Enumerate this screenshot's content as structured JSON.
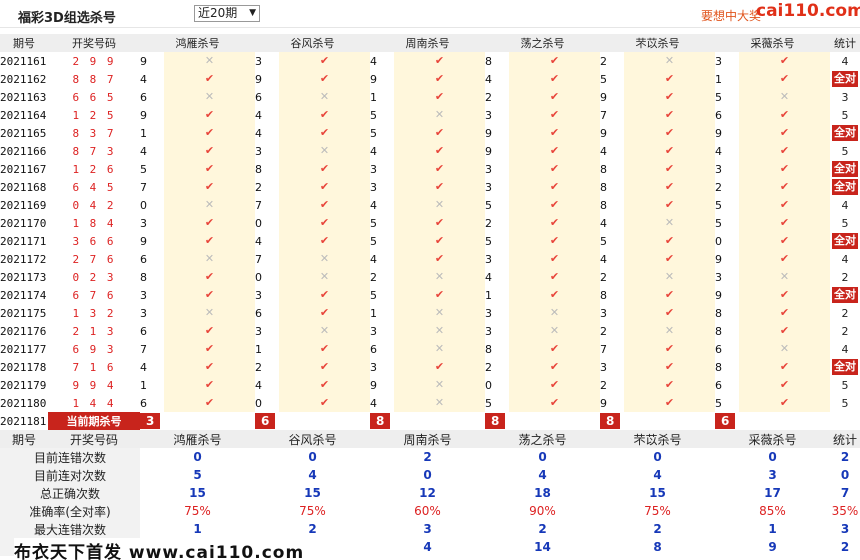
{
  "header": {
    "title": "福彩3D组选杀号",
    "period_select": "近20期",
    "promo_text": "要想中大奖",
    "logo": "cai110.com"
  },
  "columns": {
    "period": "期号",
    "draw": "开奖号码",
    "killers": [
      "鸿雁杀号",
      "谷风杀号",
      "周南杀号",
      "荡之杀号",
      "芣苡杀号",
      "采薇杀号"
    ],
    "total": "统计"
  },
  "rows": [
    {
      "period": "2021161",
      "num": "2 9 9",
      "k": [
        [
          9,
          0
        ],
        [
          3,
          1
        ],
        [
          4,
          1
        ],
        [
          8,
          1
        ],
        [
          2,
          0
        ],
        [
          3,
          1
        ]
      ],
      "total": "4"
    },
    {
      "period": "2021162",
      "num": "8 8 7",
      "k": [
        [
          4,
          1
        ],
        [
          9,
          1
        ],
        [
          9,
          1
        ],
        [
          4,
          1
        ],
        [
          5,
          1
        ],
        [
          1,
          1
        ]
      ],
      "total": "全对"
    },
    {
      "period": "2021163",
      "num": "6 6 5",
      "k": [
        [
          6,
          0
        ],
        [
          6,
          0
        ],
        [
          1,
          1
        ],
        [
          2,
          1
        ],
        [
          9,
          1
        ],
        [
          5,
          0
        ]
      ],
      "total": "3"
    },
    {
      "period": "2021164",
      "num": "1 2 5",
      "k": [
        [
          9,
          1
        ],
        [
          4,
          1
        ],
        [
          5,
          0
        ],
        [
          3,
          1
        ],
        [
          7,
          1
        ],
        [
          6,
          1
        ]
      ],
      "total": "5"
    },
    {
      "period": "2021165",
      "num": "8 3 7",
      "k": [
        [
          1,
          1
        ],
        [
          4,
          1
        ],
        [
          5,
          1
        ],
        [
          9,
          1
        ],
        [
          9,
          1
        ],
        [
          9,
          1
        ]
      ],
      "total": "全对"
    },
    {
      "period": "2021166",
      "num": "8 7 3",
      "k": [
        [
          4,
          1
        ],
        [
          3,
          0
        ],
        [
          4,
          1
        ],
        [
          9,
          1
        ],
        [
          4,
          1
        ],
        [
          4,
          1
        ]
      ],
      "total": "5"
    },
    {
      "period": "2021167",
      "num": "1 2 6",
      "k": [
        [
          5,
          1
        ],
        [
          8,
          1
        ],
        [
          3,
          1
        ],
        [
          3,
          1
        ],
        [
          8,
          1
        ],
        [
          3,
          1
        ]
      ],
      "total": "全对"
    },
    {
      "period": "2021168",
      "num": "6 4 5",
      "k": [
        [
          7,
          1
        ],
        [
          2,
          1
        ],
        [
          3,
          1
        ],
        [
          3,
          1
        ],
        [
          8,
          1
        ],
        [
          2,
          1
        ]
      ],
      "total": "全对"
    },
    {
      "period": "2021169",
      "num": "0 4 2",
      "k": [
        [
          0,
          0
        ],
        [
          7,
          1
        ],
        [
          4,
          0
        ],
        [
          5,
          1
        ],
        [
          8,
          1
        ],
        [
          5,
          1
        ]
      ],
      "total": "4"
    },
    {
      "period": "2021170",
      "num": "1 8 4",
      "k": [
        [
          3,
          1
        ],
        [
          0,
          1
        ],
        [
          5,
          1
        ],
        [
          2,
          1
        ],
        [
          4,
          0
        ],
        [
          5,
          1
        ]
      ],
      "total": "5"
    },
    {
      "period": "2021171",
      "num": "3 6 6",
      "k": [
        [
          9,
          1
        ],
        [
          4,
          1
        ],
        [
          5,
          1
        ],
        [
          5,
          1
        ],
        [
          5,
          1
        ],
        [
          0,
          1
        ]
      ],
      "total": "全对"
    },
    {
      "period": "2021172",
      "num": "2 7 6",
      "k": [
        [
          6,
          0
        ],
        [
          7,
          0
        ],
        [
          4,
          1
        ],
        [
          3,
          1
        ],
        [
          4,
          1
        ],
        [
          9,
          1
        ]
      ],
      "total": "4"
    },
    {
      "period": "2021173",
      "num": "0 2 3",
      "k": [
        [
          8,
          1
        ],
        [
          0,
          0
        ],
        [
          2,
          0
        ],
        [
          4,
          1
        ],
        [
          2,
          0
        ],
        [
          3,
          0
        ]
      ],
      "total": "2"
    },
    {
      "period": "2021174",
      "num": "6 7 6",
      "k": [
        [
          3,
          1
        ],
        [
          3,
          1
        ],
        [
          5,
          1
        ],
        [
          1,
          1
        ],
        [
          8,
          1
        ],
        [
          9,
          1
        ]
      ],
      "total": "全对"
    },
    {
      "period": "2021175",
      "num": "1 3 2",
      "k": [
        [
          3,
          0
        ],
        [
          6,
          1
        ],
        [
          1,
          0
        ],
        [
          3,
          0
        ],
        [
          3,
          1
        ],
        [
          8,
          1
        ]
      ],
      "total": "2"
    },
    {
      "period": "2021176",
      "num": "2 1 3",
      "k": [
        [
          6,
          1
        ],
        [
          3,
          0
        ],
        [
          3,
          0
        ],
        [
          3,
          0
        ],
        [
          2,
          0
        ],
        [
          8,
          1
        ]
      ],
      "total": "2"
    },
    {
      "period": "2021177",
      "num": "6 9 3",
      "k": [
        [
          7,
          1
        ],
        [
          1,
          1
        ],
        [
          6,
          0
        ],
        [
          8,
          1
        ],
        [
          7,
          1
        ],
        [
          6,
          0
        ]
      ],
      "total": "4"
    },
    {
      "period": "2021178",
      "num": "7 1 6",
      "k": [
        [
          4,
          1
        ],
        [
          2,
          1
        ],
        [
          3,
          1
        ],
        [
          2,
          1
        ],
        [
          3,
          1
        ],
        [
          8,
          1
        ]
      ],
      "total": "全对"
    },
    {
      "period": "2021179",
      "num": "9 9 4",
      "k": [
        [
          1,
          1
        ],
        [
          4,
          1
        ],
        [
          9,
          0
        ],
        [
          0,
          1
        ],
        [
          2,
          1
        ],
        [
          6,
          1
        ]
      ],
      "total": "5"
    },
    {
      "period": "2021180",
      "num": "1 4 4",
      "k": [
        [
          6,
          1
        ],
        [
          0,
          1
        ],
        [
          4,
          0
        ],
        [
          5,
          1
        ],
        [
          9,
          1
        ],
        [
          5,
          1
        ]
      ],
      "total": "5"
    }
  ],
  "current": {
    "period": "2021181",
    "label": "当前期杀号",
    "picks": [
      "3",
      "6",
      "8",
      "8",
      "8",
      "6"
    ]
  },
  "stats": {
    "rows": [
      {
        "label": "目前连错次数",
        "values": [
          "0",
          "0",
          "2",
          "0",
          "0",
          "0"
        ],
        "total": "2"
      },
      {
        "label": "目前连对次数",
        "values": [
          "5",
          "4",
          "0",
          "4",
          "4",
          "3"
        ],
        "total": "0"
      },
      {
        "label": "总正确次数",
        "values": [
          "15",
          "15",
          "12",
          "18",
          "15",
          "17"
        ],
        "total": "7"
      },
      {
        "label": "准确率(全对率)",
        "values": [
          "75%",
          "75%",
          "60%",
          "90%",
          "75%",
          "85%"
        ],
        "total": "35%"
      },
      {
        "label": "最大连错次数",
        "values": [
          "1",
          "2",
          "3",
          "2",
          "2",
          "1"
        ],
        "total": "3"
      },
      {
        "label": "",
        "values": [
          "",
          "",
          "4",
          "14",
          "8",
          "9"
        ],
        "total": "2"
      }
    ]
  },
  "footer": "布衣天下首发 www.cai110.com"
}
